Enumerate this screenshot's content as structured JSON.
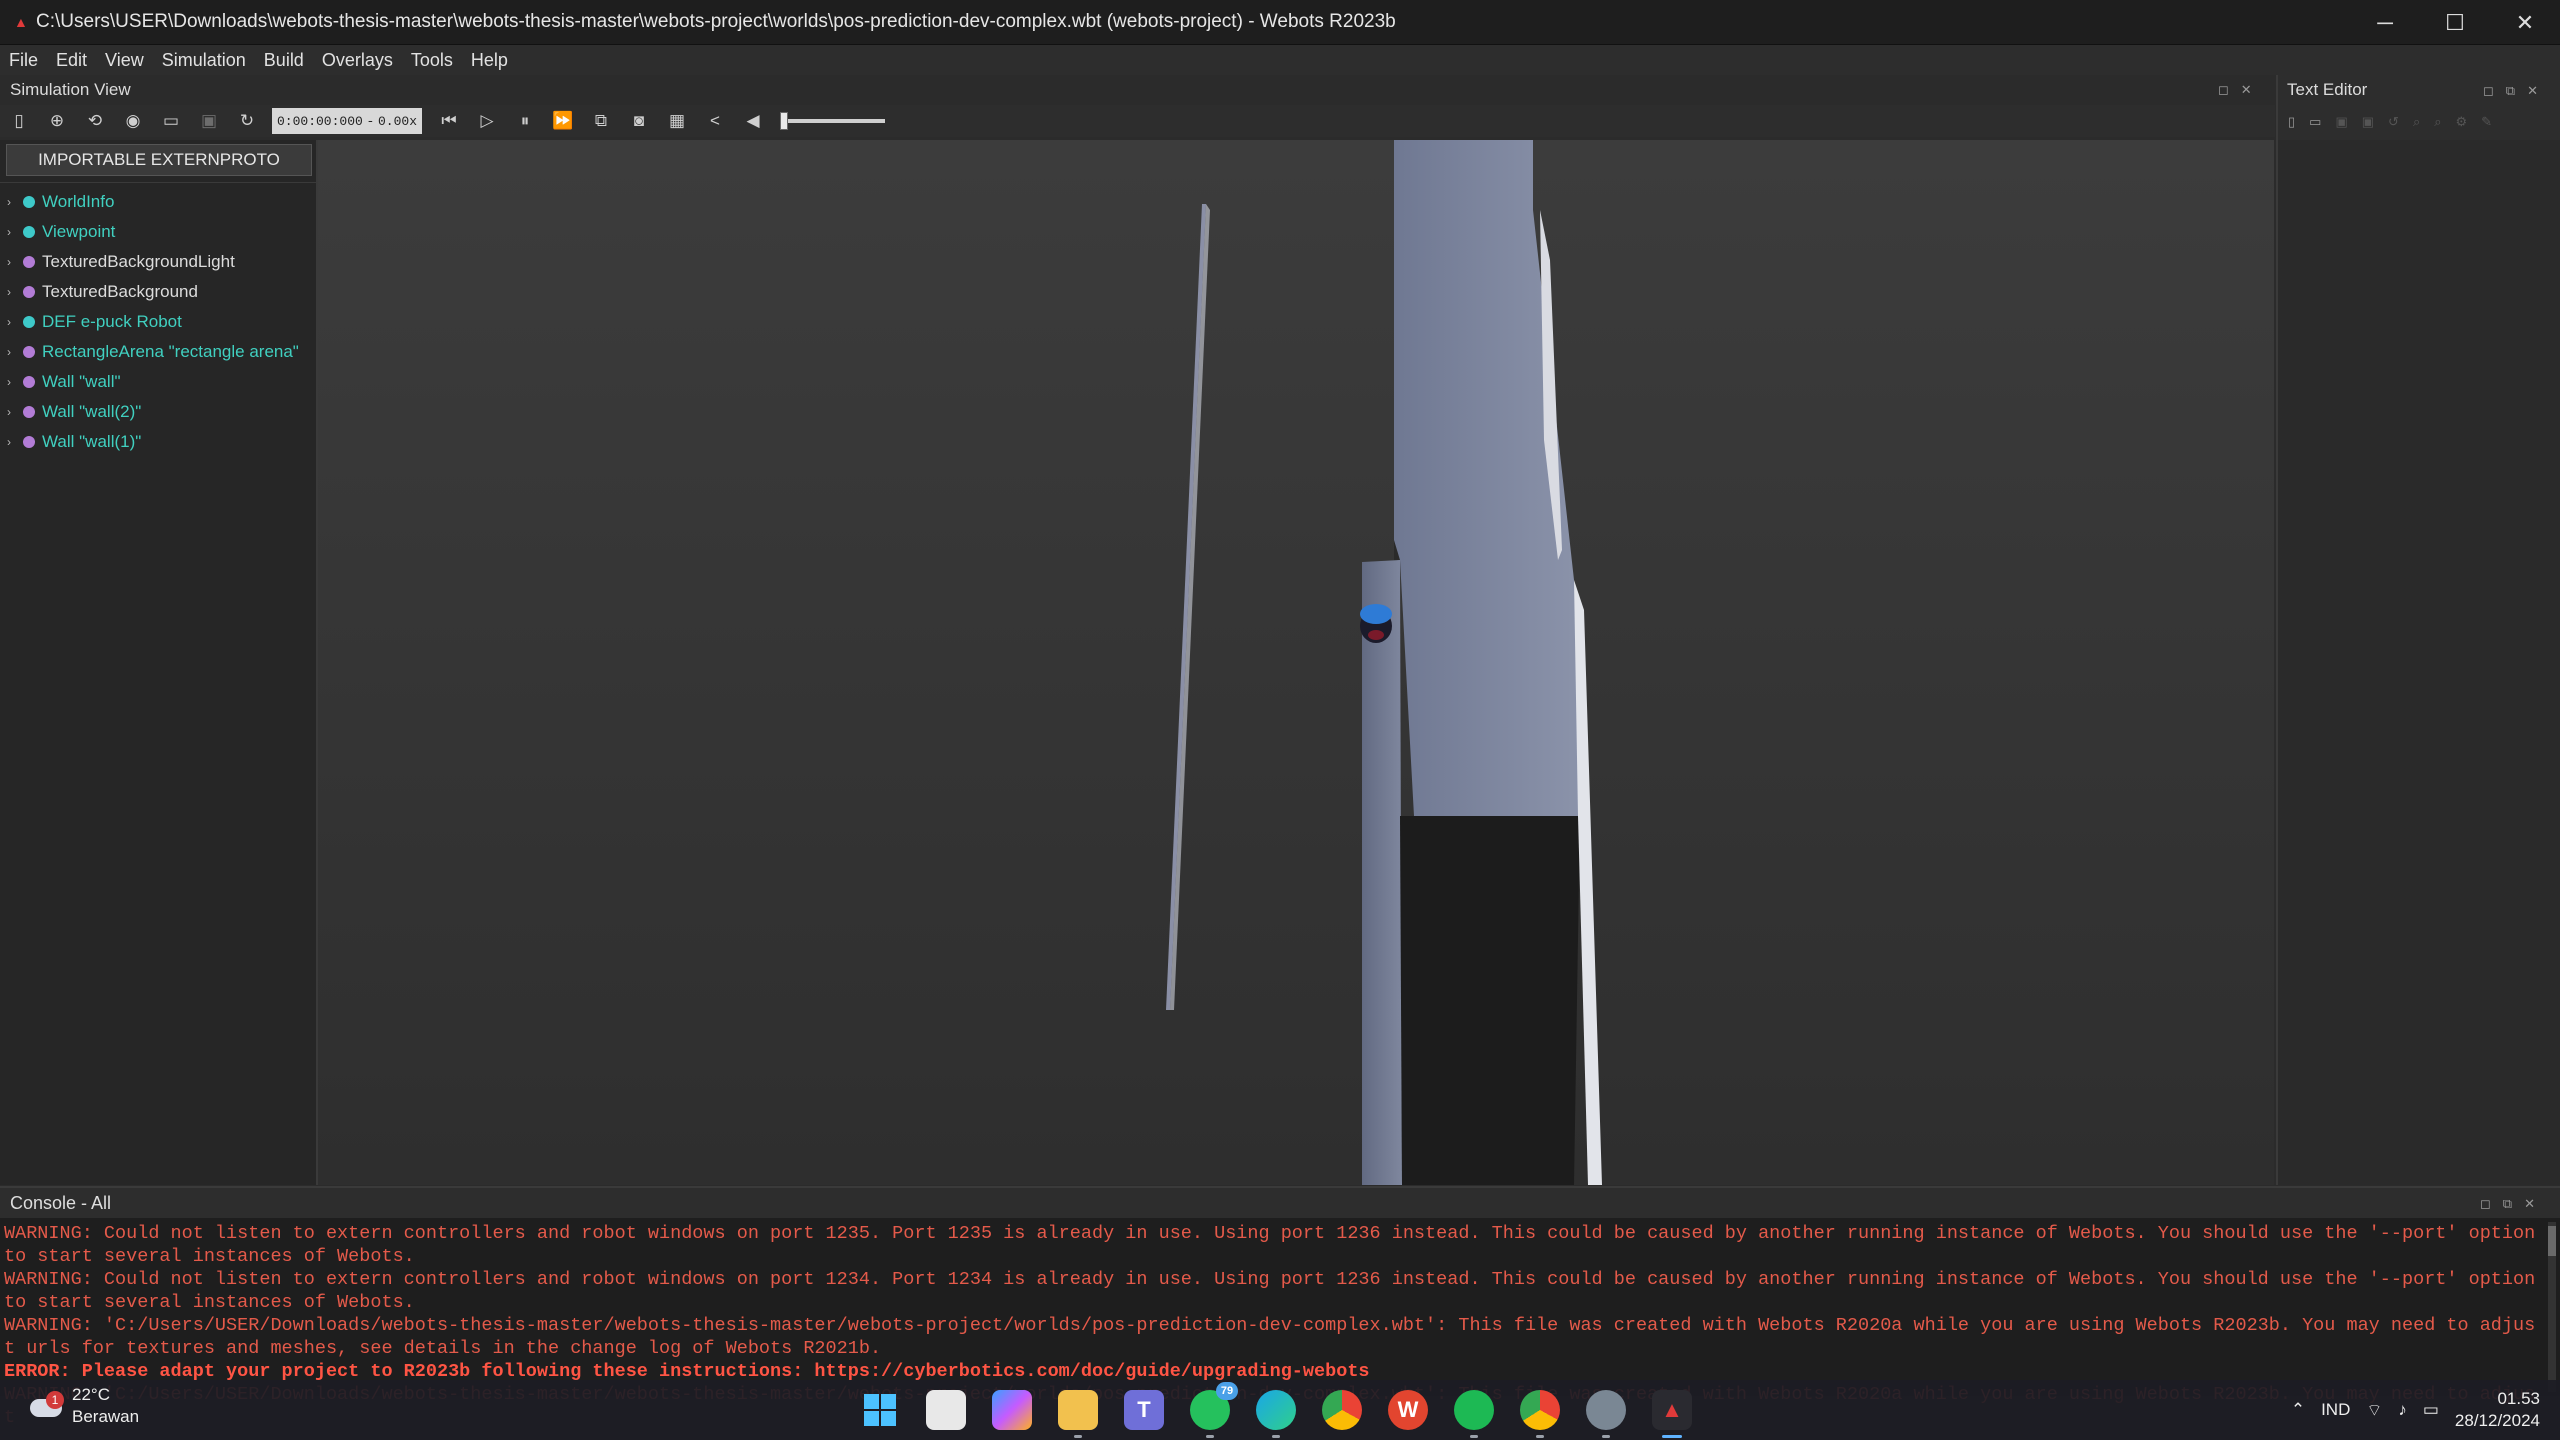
{
  "window": {
    "title": "C:\\Users\\USER\\Downloads\\webots-thesis-master\\webots-thesis-master\\webots-project\\worlds\\pos-prediction-dev-complex.wbt (webots-project) - Webots R2023b",
    "minimize": "─",
    "maximize": "☐",
    "close": "✕"
  },
  "menu": [
    "File",
    "Edit",
    "View",
    "Simulation",
    "Build",
    "Overlays",
    "Tools",
    "Help"
  ],
  "simulation_view": {
    "title": "Simulation View",
    "time": "0:00:00:000",
    "time_sep": "-",
    "speed": "0.00x",
    "volume": 0
  },
  "scene_tree": {
    "extern_button": "IMPORTABLE EXTERNPROTO",
    "nodes": [
      {
        "label": "WorldInfo",
        "color": "#3ec9c9",
        "label_color": "#40d0c0"
      },
      {
        "label": "Viewpoint",
        "color": "#3ec9c9",
        "label_color": "#40d0c0"
      },
      {
        "label": "TexturedBackgroundLight",
        "color": "#b27cd6",
        "label_color": "#dcdcdc"
      },
      {
        "label": "TexturedBackground",
        "color": "#b27cd6",
        "label_color": "#dcdcdc"
      },
      {
        "label": "DEF e-puck Robot",
        "color": "#3ec9c9",
        "label_color": "#40d0c0"
      },
      {
        "label": "RectangleArena \"rectangle arena\"",
        "color": "#b27cd6",
        "label_color": "#40d0c0"
      },
      {
        "label": "Wall \"wall\"",
        "color": "#b27cd6",
        "label_color": "#40d0c0"
      },
      {
        "label": "Wall \"wall(2)\"",
        "color": "#b27cd6",
        "label_color": "#40d0c0"
      },
      {
        "label": "Wall \"wall(1)\"",
        "color": "#b27cd6",
        "label_color": "#40d0c0"
      }
    ]
  },
  "text_editor": {
    "title": "Text Editor"
  },
  "console": {
    "title": "Console - All",
    "lines": [
      {
        "kind": "warn",
        "text": "WARNING: Could not listen to extern controllers and robot windows on port 1235. Port 1235 is already in use. Using port 1236 instead. This could be caused by another running instance of Webots. You should use the '--port' option to start several instances of Webots."
      },
      {
        "kind": "warn",
        "text": "WARNING: Could not listen to extern controllers and robot windows on port 1234. Port 1234 is already in use. Using port 1236 instead. This could be caused by another running instance of Webots. You should use the '--port' option to start several instances of Webots."
      },
      {
        "kind": "warn",
        "text": "WARNING: 'C:/Users/USER/Downloads/webots-thesis-master/webots-thesis-master/webots-project/worlds/pos-prediction-dev-complex.wbt': This file was created with Webots R2020a while you are using Webots R2023b. You may need to adjust urls for textures and meshes, see details in the change log of Webots R2021b."
      },
      {
        "kind": "err",
        "text": "ERROR: Please adapt your project to R2023b following these instructions: https://cyberbotics.com/doc/guide/upgrading-webots"
      },
      {
        "kind": "warn",
        "text": "WARNING: 'C:/Users/USER/Downloads/webots-thesis-master/webots-thesis-master/webots-project/worlds/pos-prediction-dev-complex.wbt': This file was created with Webots R2020a while you are using Webots R2023b. You may need to adjust"
      }
    ]
  },
  "taskbar": {
    "weather_temp": "22°C",
    "weather_desc": "Berawan",
    "weather_badge": "1",
    "whatsapp_badge": "79",
    "language": "IND",
    "time": "01.53",
    "date": "28/12/2024"
  },
  "colors": {
    "accent": "#5fb3ff",
    "warning": "#e45a4a",
    "error": "#ff5544",
    "robot_blue": "#2e7bd6"
  }
}
